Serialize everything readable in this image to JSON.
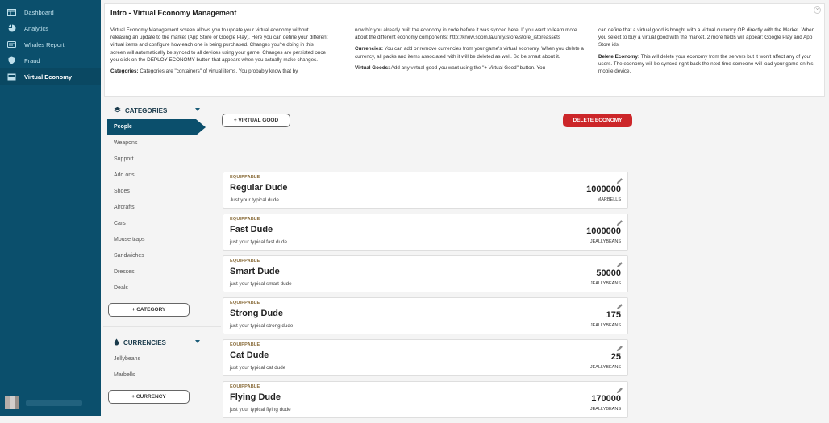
{
  "sidebar": {
    "items": [
      {
        "label": "Dashboard",
        "icon": "dashboard-icon"
      },
      {
        "label": "Analytics",
        "icon": "analytics-icon"
      },
      {
        "label": "Whales Report",
        "icon": "whales-icon"
      },
      {
        "label": "Fraud",
        "icon": "shield-icon"
      },
      {
        "label": "Virtual Economy",
        "icon": "economy-icon",
        "active": true
      }
    ]
  },
  "intro": {
    "title": "Intro - Virtual Economy Management",
    "col1_p1": "Virtual Economy Management screen allows you to update your virtual economy without releasing an update to the market (App Store or Google Play). Here you can define your different virtual items and configure how each one is being purchased. Changes you're doing in this screen will automatically be synced to all devices using your game. Changes are persisted once you click on the DEPLOY ECONOMY button that appears when you actually make changes.",
    "col1_p2_label": "Categories:",
    "col1_p2": " Categories are \"containers\" of virtual items. You probably know that by",
    "col2_p1": "now b/c you already built the economy in code before it was synced here. If you want to learn more about the different economy components: http://know.soom.la/unity/store/store_istoreassets",
    "col2_p2_label": "Currencies:",
    "col2_p2": " You can add or remove currencies from your game's virtual economy. When you delete a currency, all packs and items associated with it will be deleted as well. So be smart about it.",
    "col2_p3_label": "Virtual Goods:",
    "col2_p3": " Add any virtual good you want using the \"+ Virtual Good\" button. You",
    "col3_p1": "can define that a virtual good is bought with a virtual currency OR directly with the Market. When you select to buy a virtual good with the market, 2 more fields will appear: Google Play and App Store ids.",
    "col3_p2_label": "Delete Economy:",
    "col3_p2": " This will delete your economy from the servers but it won't affect any of your users. The economy will be synced right back the next time someone will load your game on his mobile device."
  },
  "categories": {
    "title": "CATEGORIES",
    "items": [
      "People",
      "Weapons",
      "Support",
      "Add ons",
      "Shoes",
      "Aircrafts",
      "Cars",
      "Mouse traps",
      "Sandwiches",
      "Dresses",
      "Deals"
    ],
    "add_label": "+ CATEGORY"
  },
  "currencies": {
    "title": "CURRENCIES",
    "items": [
      "Jellybeans",
      "Marbells"
    ],
    "add_label": "+ CURRENCY"
  },
  "toolbar": {
    "add_good_label": "+ VIRTUAL GOOD",
    "delete_label": "DELETE ECONOMY",
    "delete_color": "#cc2629"
  },
  "goods": [
    {
      "tag": "EQUIPPABLE",
      "name": "Regular Dude",
      "desc": "Just your typical dude",
      "price": "1000000",
      "currency": "MARBELLS"
    },
    {
      "tag": "EQUIPPABLE",
      "name": "Fast Dude",
      "desc": "just your typical fast dude",
      "price": "1000000",
      "currency": "JEALLYBEANS"
    },
    {
      "tag": "EQUIPPABLE",
      "name": "Smart Dude",
      "desc": "just your typical smart dude",
      "price": "50000",
      "currency": "JEALLYBEANS"
    },
    {
      "tag": "EQUIPPABLE",
      "name": "Strong Dude",
      "desc": "just your typical strong dude",
      "price": "175",
      "currency": "JEALLYBEANS"
    },
    {
      "tag": "EQUIPPABLE",
      "name": "Cat Dude",
      "desc": "just your typical cat dude",
      "price": "25",
      "currency": "JEALLYBEANS"
    },
    {
      "tag": "EQUIPPABLE",
      "name": "Flying Dude",
      "desc": "just your typical flying dude",
      "price": "170000",
      "currency": "JEALLYBEANS"
    }
  ]
}
